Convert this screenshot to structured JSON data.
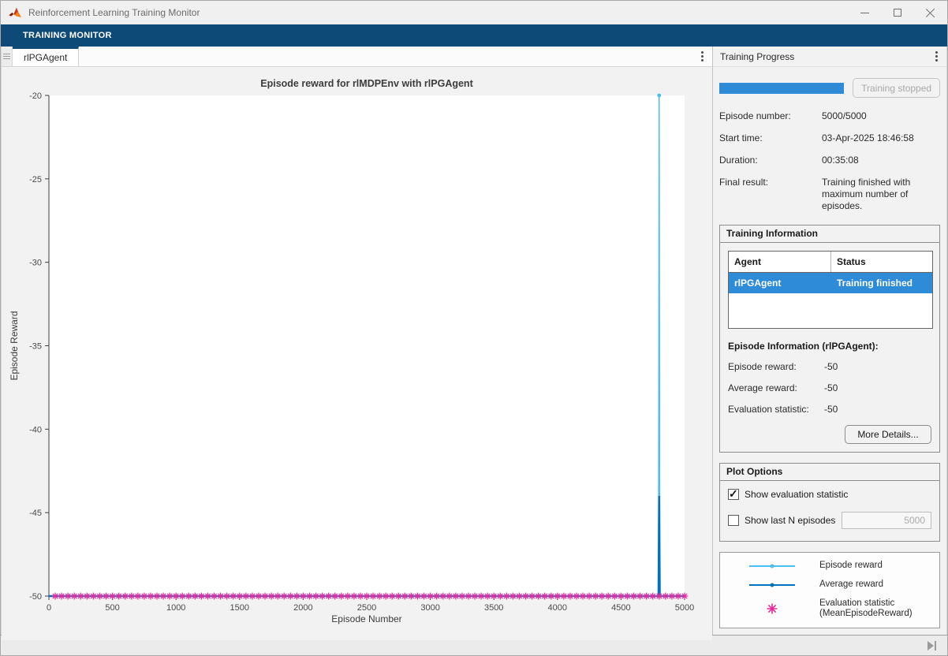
{
  "window": {
    "title": "Reinforcement Learning Training Monitor"
  },
  "ribbon": {
    "tab_label": "TRAINING MONITOR"
  },
  "document": {
    "tab_label": "rlPGAgent"
  },
  "colors": {
    "ribbon_blue": "#0d4a77",
    "selection_blue": "#2e8bd8",
    "episode_reward": "#4DBEEE",
    "average_reward": "#0072BD",
    "evaluation_magenta": "#E8289E"
  },
  "training_progress": {
    "title": "Training Progress",
    "progress_percent": 100,
    "stop_button_label": "Training stopped",
    "fields": [
      {
        "label": "Episode number:",
        "value": "5000/5000"
      },
      {
        "label": "Start time:",
        "value": "03-Apr-2025 18:46:58"
      },
      {
        "label": "Duration:",
        "value": "00:35:08"
      },
      {
        "label": "Final result:",
        "value": "Training finished with maximum number of episodes."
      }
    ]
  },
  "training_information": {
    "title": "Training Information",
    "table": {
      "headers": [
        "Agent",
        "Status"
      ],
      "rows": [
        {
          "agent": "rlPGAgent",
          "status": "Training finished",
          "selected": true
        }
      ]
    },
    "episode_info_title": "Episode Information (rlPGAgent):",
    "fields": [
      {
        "label": "Episode reward:",
        "value": "-50"
      },
      {
        "label": "Average reward:",
        "value": "-50"
      },
      {
        "label": "Evaluation statistic:",
        "value": "-50"
      }
    ],
    "more_details_button_label": "More Details..."
  },
  "plot_options": {
    "title": "Plot Options",
    "options": [
      {
        "label": "Show evaluation statistic",
        "checked": true
      },
      {
        "label": "Show last N episodes",
        "checked": false,
        "input_value": "5000",
        "input_disabled": true
      }
    ]
  },
  "legend": {
    "entries": [
      {
        "label": "Episode reward",
        "sublabel": "",
        "marker": "line-dot",
        "color": "#4DBEEE"
      },
      {
        "label": "Average reward",
        "sublabel": "",
        "marker": "line-dot",
        "color": "#0072BD"
      },
      {
        "label": "Evaluation statistic",
        "sublabel": "(MeanEpisodeReward)",
        "marker": "asterisk",
        "color": "#E8289E"
      }
    ]
  },
  "chart_data": {
    "type": "line",
    "title": "Episode reward for rlMDPEnv with rlPGAgent",
    "xlabel": "Episode Number",
    "ylabel": "Episode Reward",
    "xlim": [
      0,
      5000
    ],
    "ylim": [
      -50,
      -20
    ],
    "xticks": [
      0,
      500,
      1000,
      1500,
      2000,
      2500,
      3000,
      3500,
      4000,
      4500,
      5000
    ],
    "yticks": [
      -50,
      -45,
      -40,
      -35,
      -30,
      -25,
      -20
    ],
    "grid": false,
    "legend_position": "external-right-panel",
    "series": [
      {
        "name": "Episode reward",
        "type": "line",
        "color": "#4DBEEE",
        "width": 1.5,
        "points": [
          [
            0,
            -50
          ],
          [
            4795,
            -50
          ],
          [
            4800,
            -20
          ],
          [
            4805,
            -50
          ],
          [
            5000,
            -50
          ]
        ],
        "peak_marker": [
          4800,
          -20
        ]
      },
      {
        "name": "Average reward",
        "type": "line",
        "color": "#0072BD",
        "width": 2.5,
        "points": [
          [
            0,
            -50
          ],
          [
            4795,
            -50
          ],
          [
            4800,
            -44
          ],
          [
            4805,
            -50
          ],
          [
            5000,
            -50
          ]
        ]
      },
      {
        "name": "Evaluation statistic (MeanEpisodeReward)",
        "type": "scatter-asterisk",
        "color": "#E8289E",
        "x_start": 50,
        "x_step": 50,
        "x_end": 5000,
        "y": -50
      }
    ],
    "annotation": "Episode reward is flat at -50 for all 5000 episodes except a single spike to -20 near episode 4800; the average reward spikes to about -44 at the same episode; the evaluation statistic equals -50 at every evaluation point (every 50 episodes)."
  }
}
